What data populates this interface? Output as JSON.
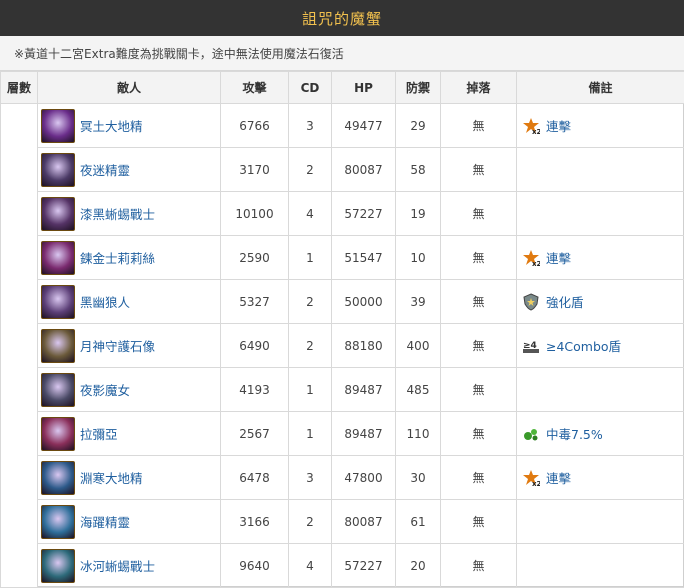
{
  "header": {
    "title": "詛咒的魔蟹"
  },
  "notice": "※黃道十二宮Extra難度為挑戰關卡，途中無法使用魔法石復活",
  "table": {
    "columns": [
      "層數",
      "敵人",
      "攻擊",
      "CD",
      "HP",
      "防禦",
      "掉落",
      "備註"
    ],
    "rows": [
      {
        "name": "冥土大地精",
        "atk": "6766",
        "cd": "3",
        "hp": "49477",
        "def": "29",
        "drop": "無",
        "note": "連擊",
        "note_icon": "combo-x2-icon",
        "avatar_color": "#6a2d8a"
      },
      {
        "name": "夜迷精靈",
        "atk": "3170",
        "cd": "2",
        "hp": "80087",
        "def": "58",
        "drop": "無",
        "note": "",
        "note_icon": "",
        "avatar_color": "#4b3a66"
      },
      {
        "name": "漆黑蜥蜴戰士",
        "atk": "10100",
        "cd": "4",
        "hp": "57227",
        "def": "19",
        "drop": "無",
        "note": "",
        "note_icon": "",
        "avatar_color": "#553366"
      },
      {
        "name": "鍊金士莉莉絲",
        "atk": "2590",
        "cd": "1",
        "hp": "51547",
        "def": "10",
        "drop": "無",
        "note": "連擊",
        "note_icon": "combo-x2-icon",
        "avatar_color": "#7a2a6f"
      },
      {
        "name": "黑幽狼人",
        "atk": "5327",
        "cd": "2",
        "hp": "50000",
        "def": "39",
        "drop": "無",
        "note": "強化盾",
        "note_icon": "shield-icon",
        "avatar_color": "#5c3f77"
      },
      {
        "name": "月神守護石像",
        "atk": "6490",
        "cd": "2",
        "hp": "88180",
        "def": "400",
        "drop": "無",
        "note": "≥4Combo盾",
        "note_icon": "combo-4-icon",
        "avatar_color": "#6b5a3a"
      },
      {
        "name": "夜影魔女",
        "atk": "4193",
        "cd": "1",
        "hp": "89487",
        "def": "485",
        "drop": "無",
        "note": "",
        "note_icon": "",
        "avatar_color": "#4a4a66"
      },
      {
        "name": "拉彌亞",
        "atk": "2567",
        "cd": "1",
        "hp": "89487",
        "def": "110",
        "drop": "無",
        "note": "中毒7.5%",
        "note_icon": "poison-icon",
        "avatar_color": "#8a2f5a"
      },
      {
        "name": "淵寒大地精",
        "atk": "6478",
        "cd": "3",
        "hp": "47800",
        "def": "30",
        "drop": "無",
        "note": "連擊",
        "note_icon": "combo-x2-icon",
        "avatar_color": "#2d5a8a"
      },
      {
        "name": "海躍精靈",
        "atk": "3166",
        "cd": "2",
        "hp": "80087",
        "def": "61",
        "drop": "無",
        "note": "",
        "note_icon": "",
        "avatar_color": "#2f6f9a"
      },
      {
        "name": "冰河蜥蜴戰士",
        "atk": "9640",
        "cd": "4",
        "hp": "57227",
        "def": "20",
        "drop": "無",
        "note": "",
        "note_icon": "",
        "avatar_color": "#2d6a7a"
      }
    ]
  }
}
